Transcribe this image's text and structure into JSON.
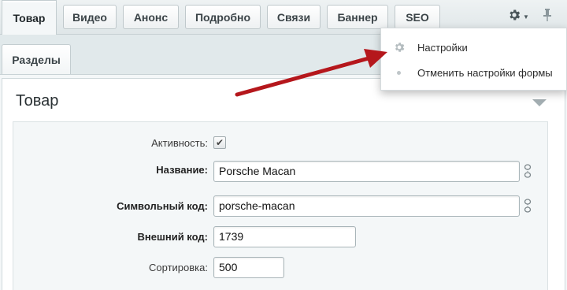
{
  "tabs": [
    {
      "label": "Товар"
    },
    {
      "label": "Видео"
    },
    {
      "label": "Анонс"
    },
    {
      "label": "Подробно"
    },
    {
      "label": "Связи"
    },
    {
      "label": "Баннер"
    },
    {
      "label": "SEO"
    }
  ],
  "subtabs": [
    {
      "label": "Разделы"
    }
  ],
  "toolbar": {
    "settings_icon": "gear-icon",
    "pin_icon": "pin-icon"
  },
  "menu": {
    "items": [
      {
        "label": "Настройки",
        "icon": "gear-icon"
      },
      {
        "label": "Отменить настройки формы",
        "icon": "dot-icon"
      }
    ]
  },
  "section": {
    "title": "Товар"
  },
  "form": {
    "active": {
      "label": "Активность:",
      "checked": true
    },
    "name": {
      "label": "Название:",
      "value": "Porsche Macan"
    },
    "code": {
      "label": "Символьный код:",
      "value": "porsche-macan"
    },
    "external": {
      "label": "Внешний код:",
      "value": "1739"
    },
    "sort": {
      "label": "Сортировка:",
      "value": "500"
    }
  },
  "colors": {
    "annotation_arrow": "#b5171c",
    "background": "#e0e8ea"
  }
}
